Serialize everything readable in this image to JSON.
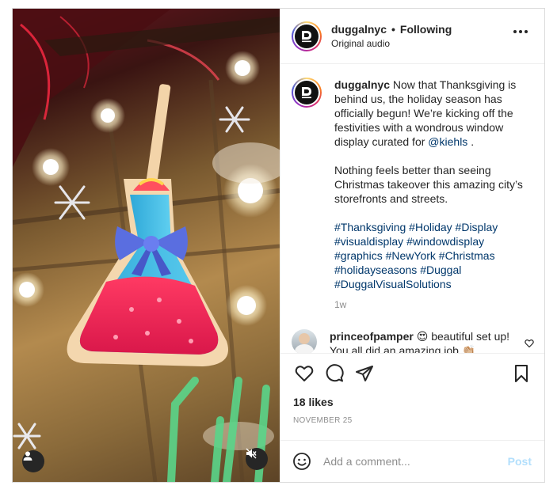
{
  "header": {
    "username": "duggalnyc",
    "separator": "•",
    "follow_status": "Following",
    "audio": "Original audio"
  },
  "caption": {
    "username": "duggalnyc",
    "text_1": "Now that Thanksgiving is behind us, the holiday season has officially begun! We’re kicking off the festivities with a wondrous window display curated for",
    "mention": "@kiehls",
    "text_1_end": ".",
    "text_2": "Nothing feels better than seeing Christmas takeover this amazing city’s storefronts and streets.",
    "hashtags": [
      "#Thanksgiving",
      "#Holiday",
      "#Display",
      "#visualdisplay",
      "#windowdisplay",
      "#graphics",
      "#NewYork",
      "#Christmas",
      "#holidayseasons",
      "#Duggal",
      "#DuggalVisualSolutions"
    ],
    "time": "1w"
  },
  "comment": {
    "username": "princeofpamper",
    "text": "😍 beautiful set up! You all did an amazing job 👏🏼"
  },
  "actions": {
    "likes": "18 likes",
    "date": "November 25"
  },
  "add_comment": {
    "placeholder": "Add a comment...",
    "post_label": "Post"
  },
  "colors": {
    "link": "#00376b",
    "post_button_disabled": "#b2dffc",
    "muted_text": "#8e8e8e"
  },
  "icons": {
    "more": "more-horizontal-icon",
    "like": "heart-icon",
    "comment": "comment-bubble-icon",
    "share": "paper-plane-icon",
    "save": "bookmark-icon",
    "emoji": "smiley-icon",
    "mute": "speaker-muted-icon",
    "tag": "user-tag-icon"
  }
}
